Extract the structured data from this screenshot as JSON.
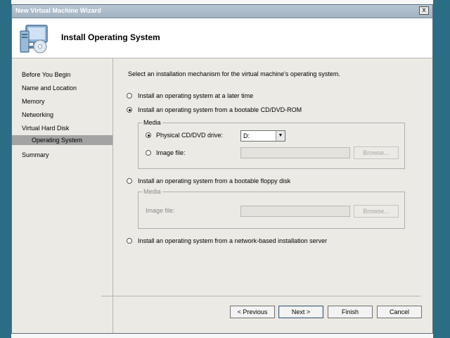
{
  "window": {
    "title": "New Virtual Machine Wizard",
    "close_glyph": "x"
  },
  "header": {
    "title": "Install Operating System",
    "icon": "computer-disk-icon"
  },
  "nav": {
    "items": [
      {
        "label": "Before You Begin"
      },
      {
        "label": "Name and Location"
      },
      {
        "label": "Memory"
      },
      {
        "label": "Networking"
      },
      {
        "label": "Virtual Hard Disk"
      },
      {
        "label": "Operating System"
      },
      {
        "label": "Summary"
      }
    ]
  },
  "main": {
    "instruction": "Select an installation mechanism for the virtual machine's operating system.",
    "options": [
      {
        "label": "Install an operating system at a later time",
        "selected": false
      },
      {
        "label": "Install an operating system from a bootable CD/DVD-ROM",
        "selected": true
      },
      {
        "label": "Install an operating system from a bootable floppy disk",
        "selected": false
      },
      {
        "label": "Install an operating system from a network-based installation server",
        "selected": false
      }
    ],
    "cd_media": {
      "group_label": "Media",
      "physical_label": "Physical CD/DVD drive:",
      "physical_selected": true,
      "drive_value": "D:",
      "image_label": "Image file:",
      "image_selected": false,
      "image_value": "",
      "browse_label": "Browse..."
    },
    "floppy_media": {
      "group_label": "Media",
      "image_label": "Image file:",
      "image_value": "",
      "browse_label": "Browse..."
    }
  },
  "footer": {
    "previous_label": "< Previous",
    "next_label": "Next >",
    "finish_label": "Finish",
    "cancel_label": "Cancel"
  }
}
